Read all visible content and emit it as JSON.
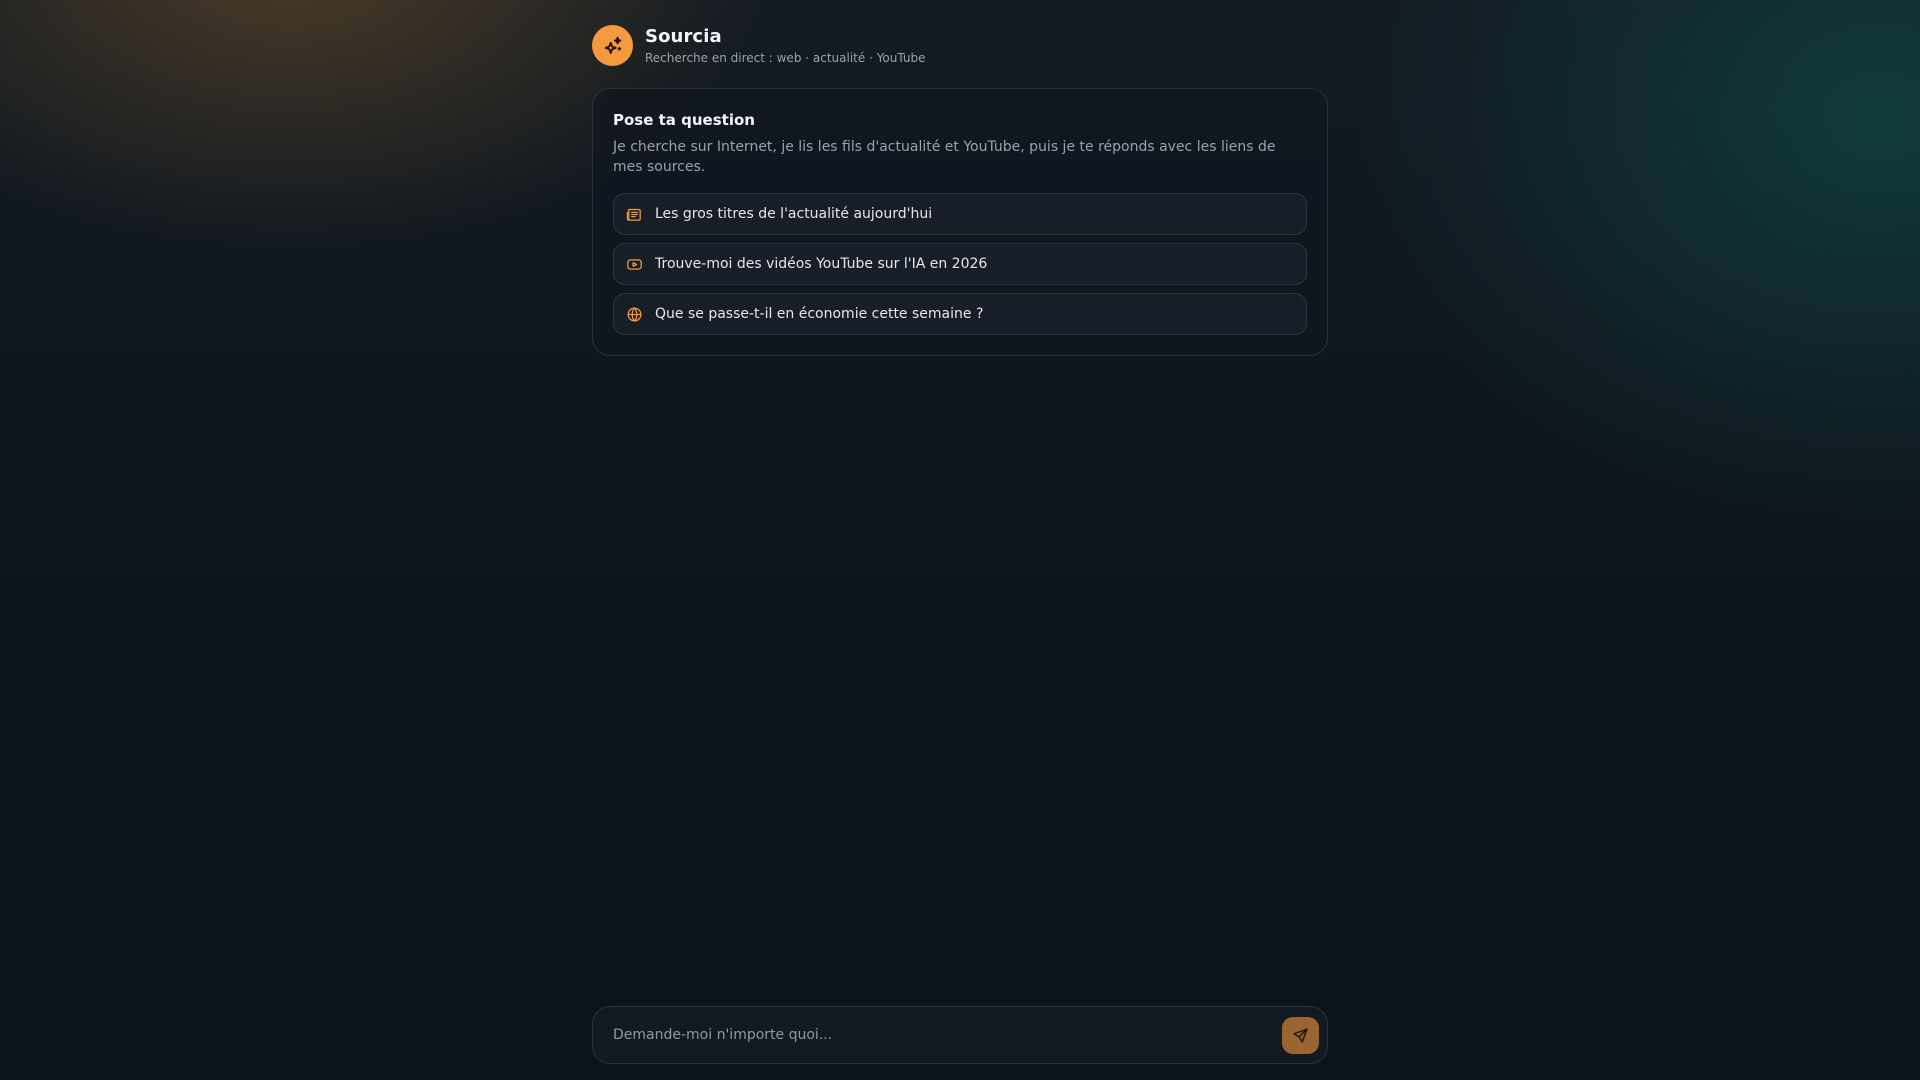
{
  "app": {
    "title": "Sourcia",
    "subtitle": "Recherche en direct : web · actualité · YouTube",
    "logo_icon": "sparkles-icon"
  },
  "welcome_card": {
    "title": "Pose ta question",
    "description": "Je cherche sur Internet, je lis les fils d'actualité et YouTube, puis je te réponds avec les liens de mes sources.",
    "suggestions": [
      {
        "icon": "newspaper-icon",
        "label": "Les gros titres de l'actualité aujourd'hui"
      },
      {
        "icon": "youtube-icon",
        "label": "Trouve-moi des vidéos YouTube sur l'IA en 2026"
      },
      {
        "icon": "globe-icon",
        "label": "Que se passe-t-il en économie cette semaine ?"
      }
    ]
  },
  "composer": {
    "placeholder": "Demande-moi n'importe quoi...",
    "value": "",
    "send_icon": "send-icon"
  },
  "colors": {
    "accent": "#f49a3e",
    "send_button": "#9a6531",
    "background": "#0e141c"
  }
}
